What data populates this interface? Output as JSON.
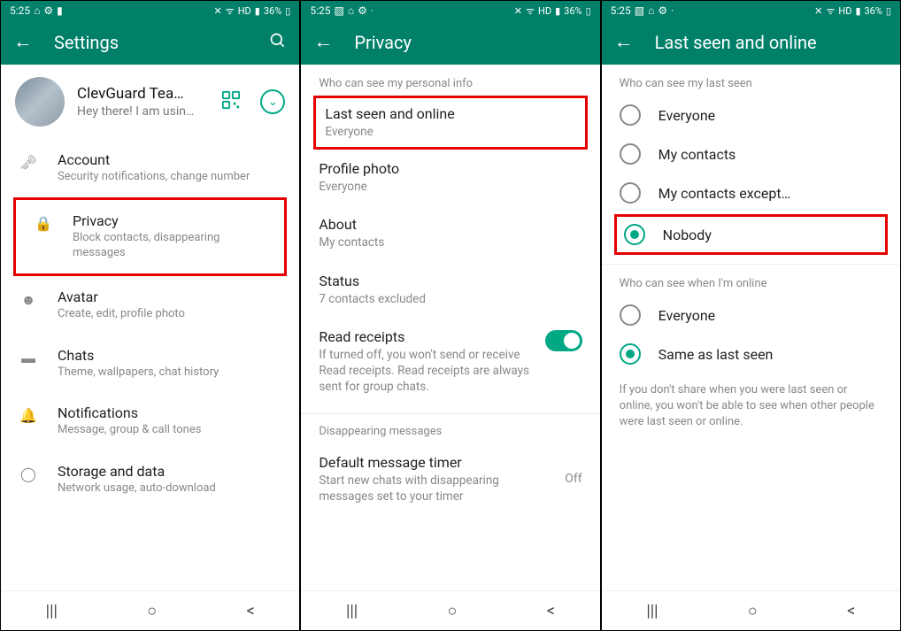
{
  "status": {
    "time": "5:25",
    "battery": "36%",
    "signal": "HD"
  },
  "screen1": {
    "header": {
      "title": "Settings"
    },
    "profile": {
      "name": "ClevGuard Tea…",
      "status": "Hey there! I am usin…"
    },
    "items": [
      {
        "title": "Account",
        "sub": "Security notifications, change number"
      },
      {
        "title": "Privacy",
        "sub": "Block contacts, disappearing messages"
      },
      {
        "title": "Avatar",
        "sub": "Create, edit, profile photo"
      },
      {
        "title": "Chats",
        "sub": "Theme, wallpapers, chat history"
      },
      {
        "title": "Notifications",
        "sub": "Message, group & call tones"
      },
      {
        "title": "Storage and data",
        "sub": "Network usage, auto-download"
      }
    ]
  },
  "screen2": {
    "header": {
      "title": "Privacy"
    },
    "section1": "Who can see my personal info",
    "items": [
      {
        "title": "Last seen and online",
        "sub": "Everyone"
      },
      {
        "title": "Profile photo",
        "sub": "Everyone"
      },
      {
        "title": "About",
        "sub": "My contacts"
      },
      {
        "title": "Status",
        "sub": "7 contacts excluded"
      }
    ],
    "read": {
      "title": "Read receipts",
      "sub": "If turned off, you won't send or receive Read receipts. Read receipts are always sent for group chats."
    },
    "section2": "Disappearing messages",
    "timer": {
      "title": "Default message timer",
      "sub": "Start new chats with disappearing messages set to your timer",
      "value": "Off"
    }
  },
  "screen3": {
    "header": {
      "title": "Last seen and online"
    },
    "section1": "Who can see my last seen",
    "opts1": [
      "Everyone",
      "My contacts",
      "My contacts except…",
      "Nobody"
    ],
    "section2": "Who can see when I'm online",
    "opts2": [
      "Everyone",
      "Same as last seen"
    ],
    "note": "If you don't share when you were last seen or online, you won't be able to see when other people were last seen or online."
  }
}
